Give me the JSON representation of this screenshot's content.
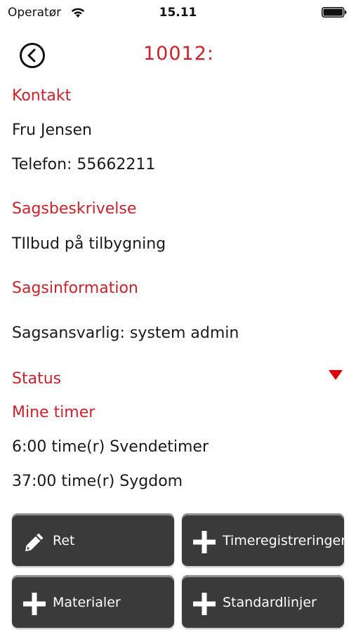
{
  "status_bar": {
    "carrier": "Operatør",
    "time": "15.11"
  },
  "header": {
    "title": "10012:"
  },
  "contact": {
    "heading": "Kontakt",
    "name": "Fru Jensen",
    "phone": "Telefon: 55662211"
  },
  "case_description": {
    "heading": "Sagsbeskrivelse",
    "text": "TIlbud på tilbygning"
  },
  "case_information": {
    "heading": "Sagsinformation",
    "responsible": "Sagsansvarlig:  system admin"
  },
  "status": {
    "heading": "Status"
  },
  "my_hours": {
    "heading": "Mine timer",
    "entries": [
      "6:00 time(r) Svendetimer",
      "37:00 time(r) Sygdom"
    ]
  },
  "actions": {
    "edit_label": "Ret",
    "time_registrations_label": "Timeregistreringer",
    "materials_label": "Materialer",
    "standard_lines_label": "Standardlinjer"
  },
  "colors": {
    "accent": "#d0212b",
    "button_bg": "#3a3a3a",
    "button_text": "#ffffff"
  }
}
